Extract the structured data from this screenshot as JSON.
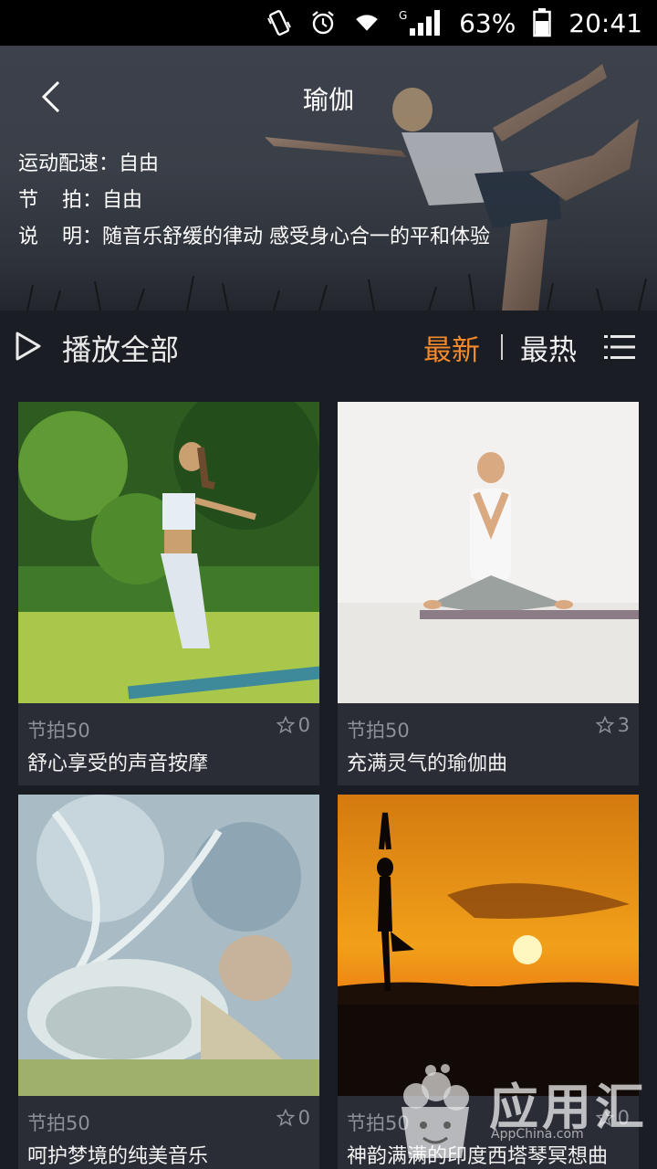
{
  "status_bar": {
    "icons": [
      "vibrate-icon",
      "alarm-icon",
      "wifi-icon",
      "cell-signal-icon",
      "battery-icon"
    ],
    "network": "G",
    "battery": "63%",
    "time": "20:41"
  },
  "header": {
    "title": "瑜伽",
    "pace_label": "运动配速：",
    "pace_value": "自由",
    "beat_label_a": "节",
    "beat_label_b": "拍：",
    "beat_value": "自由",
    "desc_label_a": "说",
    "desc_label_b": "明：",
    "desc_value": "随音乐舒缓的律动 感受身心合一的平和体验"
  },
  "toolbar": {
    "play_all": "播放全部",
    "tab_new": "最新",
    "tab_hot": "最热",
    "active_color": "#f08a2c"
  },
  "cards": [
    {
      "beat": "节拍50",
      "stars": "0",
      "name": "舒心享受的声音按摩"
    },
    {
      "beat": "节拍50",
      "stars": "3",
      "name": "充满灵气的瑜伽曲"
    },
    {
      "beat": "节拍50",
      "stars": "0",
      "name": "呵护梦境的纯美音乐"
    },
    {
      "beat": "节拍50",
      "stars": "0",
      "name": "神韵满满的印度西塔琴冥想曲"
    }
  ],
  "watermark": {
    "text": "应用汇",
    "sub": "AppChina.com"
  }
}
